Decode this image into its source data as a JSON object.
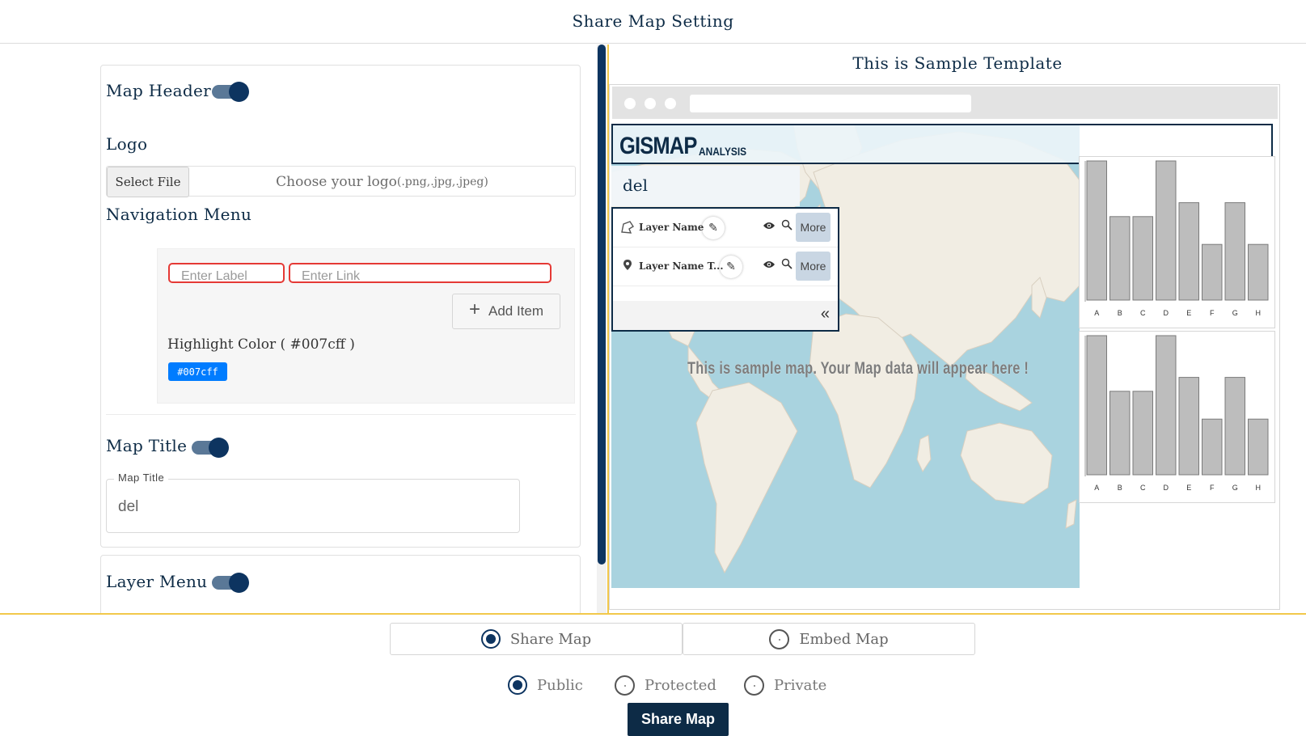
{
  "page": {
    "title": "Share Map Setting"
  },
  "settings": {
    "map_header": {
      "label": "Map Header",
      "enabled": true
    },
    "logo": {
      "label": "Logo",
      "select_file_label": "Select File",
      "placeholder": "Choose your logo",
      "placeholder_ext": "(.png,.jpg,.jpeg)"
    },
    "navigation_menu": {
      "label": "Navigation Menu",
      "label_input_placeholder": "Enter Label",
      "link_input_placeholder": "Enter Link",
      "add_item_label": "Add Item",
      "highlight_label": "Highlight Color ( #007cff )",
      "highlight_color": "#007cff",
      "highlight_chip_text": "#007cff"
    },
    "map_title": {
      "label": "Map Title",
      "enabled": true,
      "field_legend": "Map Title",
      "value": "del"
    },
    "layer_menu": {
      "label": "Layer Menu",
      "enabled": true
    }
  },
  "preview": {
    "title": "This is Sample Template",
    "logo_main": "GISMAP",
    "logo_sub": "ANALYSIS",
    "map_title": "del",
    "layers": [
      {
        "name": "Layer Name",
        "icon": "polygon-icon",
        "more_label": "More"
      },
      {
        "name": "Layer Name T...",
        "icon": "pin-icon",
        "more_label": "More"
      }
    ],
    "collapse_glyph": "«",
    "map_message": "This is sample map. Your Map data will appear here !",
    "charts": [
      {
        "type": "bar",
        "categories": [
          "A",
          "B",
          "C",
          "D",
          "E",
          "F",
          "G",
          "H"
        ],
        "values": [
          100,
          60,
          60,
          100,
          70,
          40,
          70,
          40
        ],
        "ylim": [
          0,
          100
        ]
      },
      {
        "type": "bar",
        "categories": [
          "A",
          "B",
          "C",
          "D",
          "E",
          "F",
          "G",
          "H"
        ],
        "values": [
          100,
          60,
          60,
          100,
          70,
          40,
          70,
          40
        ],
        "ylim": [
          0,
          100
        ]
      }
    ]
  },
  "share": {
    "modes": [
      {
        "label": "Share Map",
        "selected": true
      },
      {
        "label": "Embed Map",
        "selected": false
      }
    ],
    "access": [
      {
        "label": "Public",
        "selected": true
      },
      {
        "label": "Protected",
        "selected": false
      },
      {
        "label": "Private",
        "selected": false
      }
    ],
    "submit_label": "Share Map"
  },
  "colors": {
    "primary": "#0d2b46",
    "accent_yellow": "#f2c84b",
    "error_red": "#e53935",
    "bar_fill": "#bdbdbd"
  }
}
